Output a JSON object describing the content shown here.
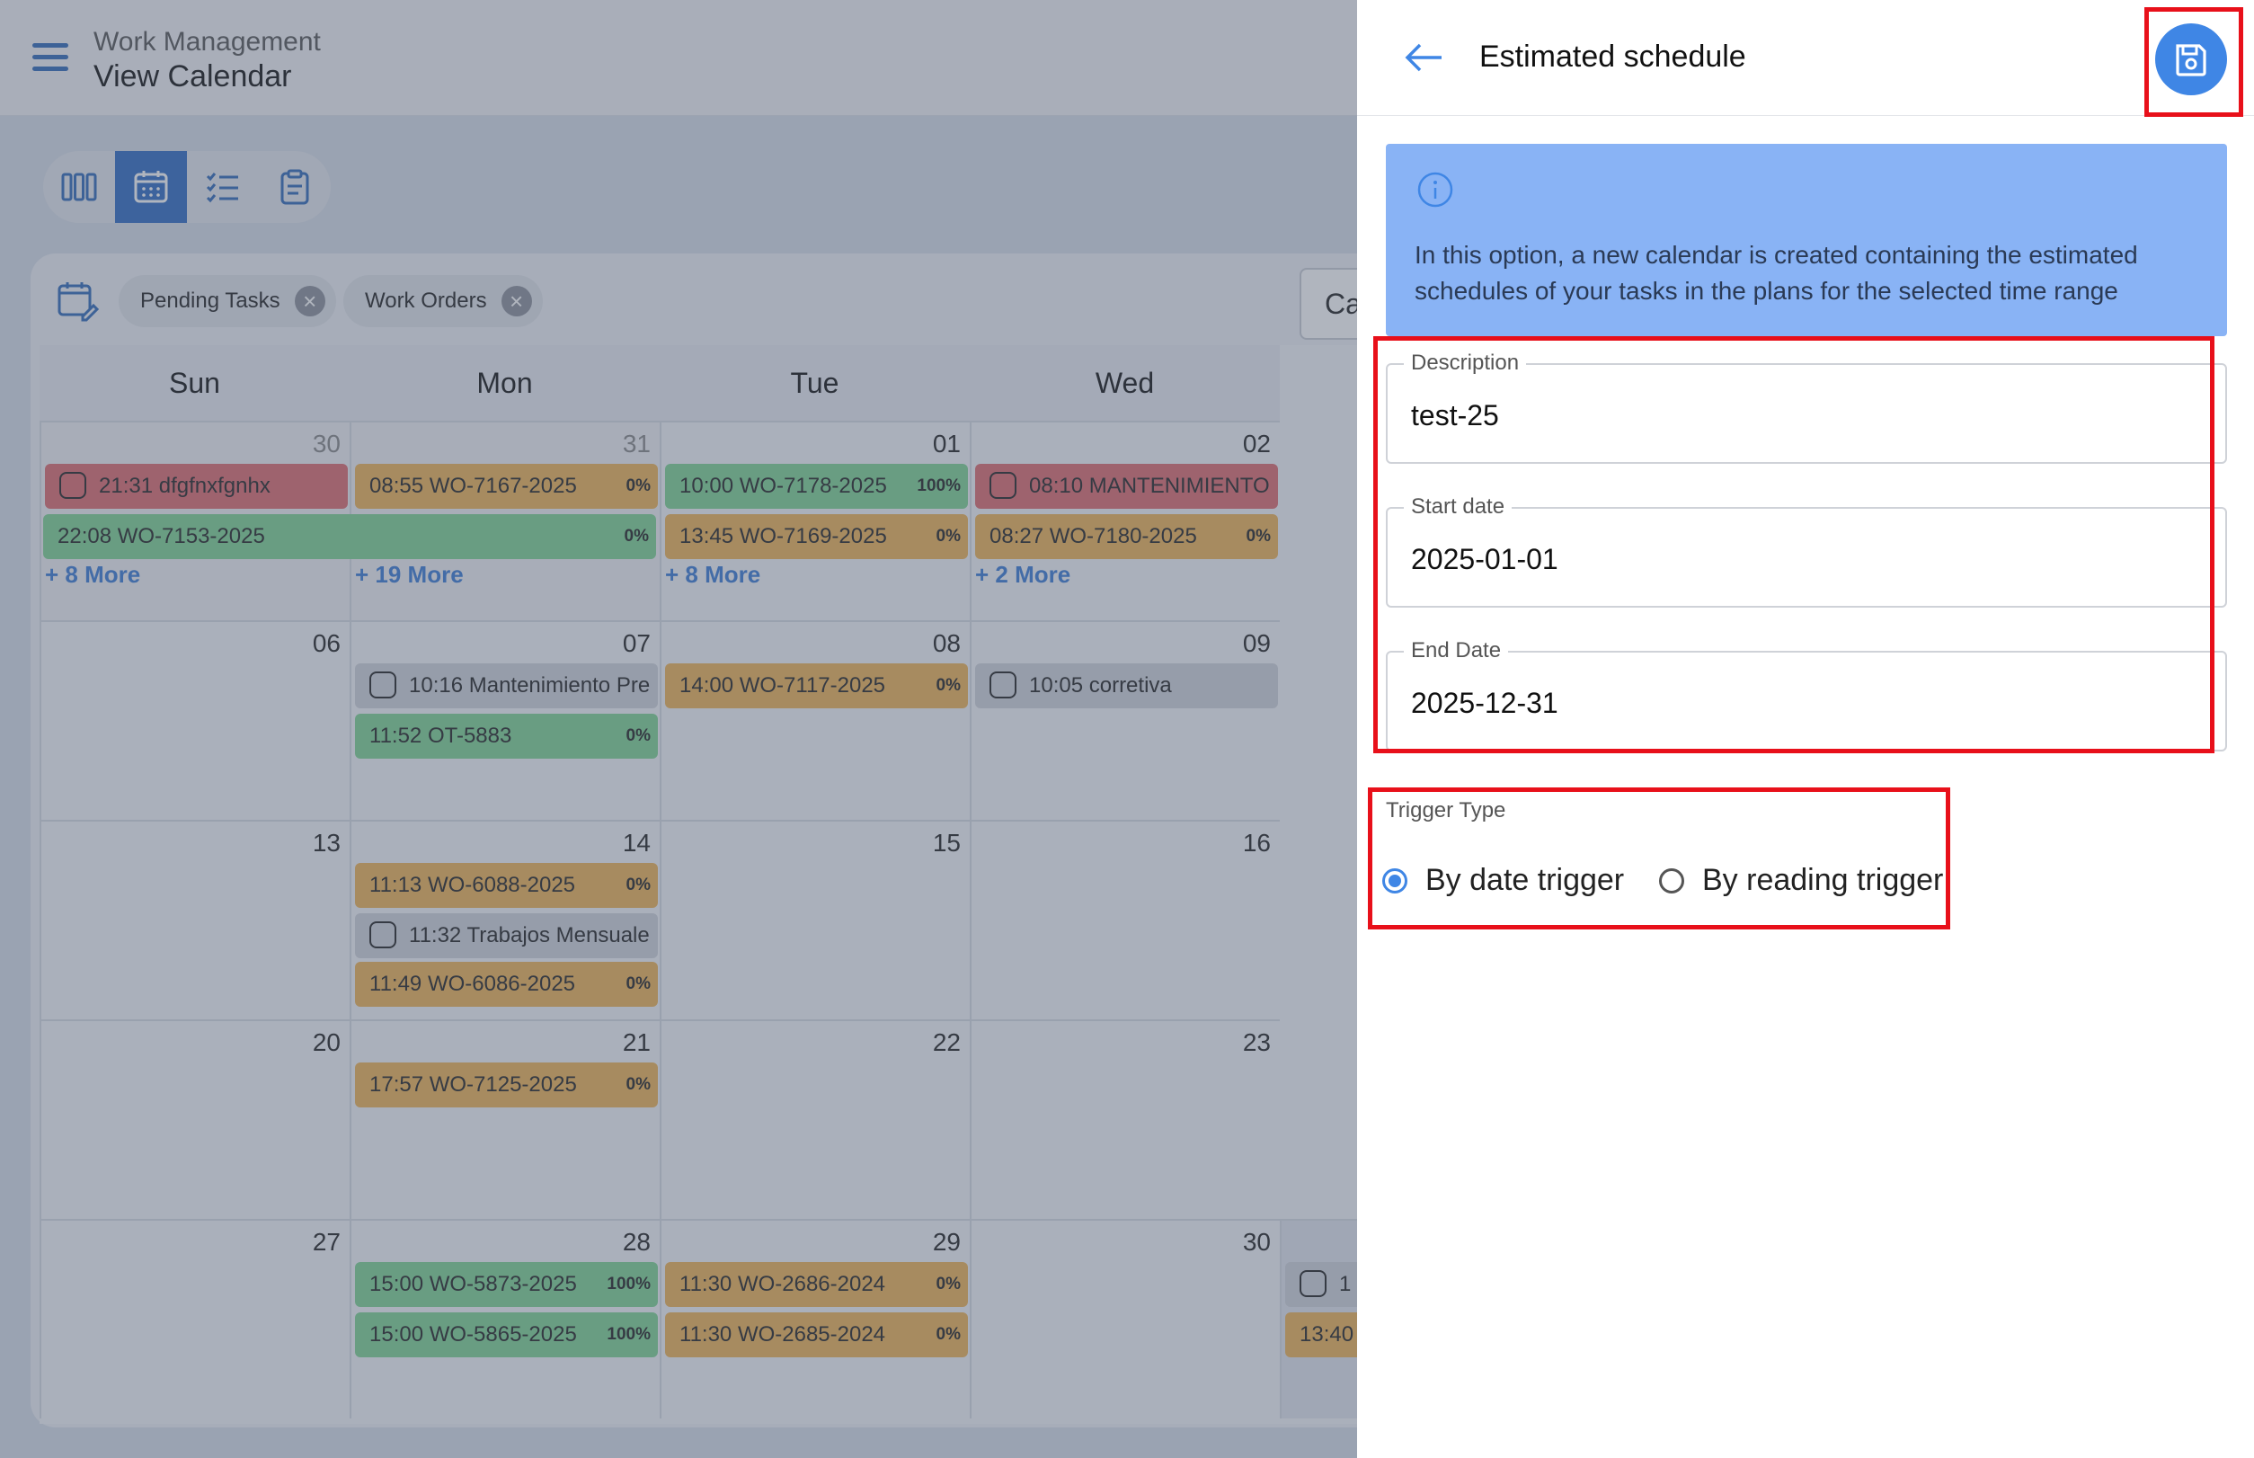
{
  "header": {
    "subtitle": "Work Management",
    "title": "View Calendar"
  },
  "filters": {
    "chips": [
      "Pending Tasks",
      "Work Orders"
    ],
    "search_partial": "Ca"
  },
  "calendar": {
    "days": [
      "Sun",
      "Mon",
      "Tue",
      "Wed"
    ],
    "weeks": [
      {
        "dates": [
          "30",
          "31",
          "01",
          "02"
        ],
        "muted": [
          true,
          true,
          false,
          false
        ],
        "cells": [
          {
            "events": [
              {
                "text": "21:31 dfgfnxfgnhx",
                "color": "red",
                "check": true
              }
            ],
            "more": "+ 8 More"
          },
          {
            "events": [
              {
                "text": "08:55 WO-7167-2025",
                "color": "orange",
                "pct": "0%"
              }
            ],
            "more": "+ 19 More"
          },
          {
            "events": [
              {
                "text": "10:00 WO-7178-2025",
                "color": "green",
                "pct": "100%"
              },
              {
                "text": "13:45 WO-7169-2025",
                "color": "orange",
                "pct": "0%"
              }
            ],
            "more": "+ 8 More"
          },
          {
            "events": [
              {
                "text": "08:10 MANTENIMIENTO",
                "color": "red",
                "check": true
              },
              {
                "text": "08:27 WO-7180-2025",
                "color": "orange",
                "pct": "0%"
              }
            ],
            "more": "+ 2 More"
          }
        ],
        "span_event": {
          "text": "22:08 WO-7153-2025",
          "color": "green",
          "pct": "0%"
        }
      },
      {
        "dates": [
          "06",
          "07",
          "08",
          "09"
        ],
        "cells": [
          {
            "events": []
          },
          {
            "events": [
              {
                "text": "10:16 Mantenimiento Pre",
                "color": "gray",
                "check": true
              },
              {
                "text": "11:52 OT-5883",
                "color": "green",
                "pct": "0%"
              }
            ]
          },
          {
            "events": [
              {
                "text": "14:00 WO-7117-2025",
                "color": "orange",
                "pct": "0%"
              }
            ]
          },
          {
            "events": [
              {
                "text": "10:05 corretiva",
                "color": "gray",
                "check": true
              }
            ]
          }
        ]
      },
      {
        "dates": [
          "13",
          "14",
          "15",
          "16"
        ],
        "cells": [
          {
            "events": []
          },
          {
            "events": [
              {
                "text": "11:13 WO-6088-2025",
                "color": "orange",
                "pct": "0%"
              },
              {
                "text": "11:32 Trabajos Mensuale",
                "color": "gray",
                "check": true
              },
              {
                "text": "11:49 WO-6086-2025",
                "color": "orange",
                "pct": "0%"
              }
            ]
          },
          {
            "events": []
          },
          {
            "events": []
          }
        ]
      },
      {
        "dates": [
          "20",
          "21",
          "22",
          "23"
        ],
        "cells": [
          {
            "events": []
          },
          {
            "events": [
              {
                "text": "17:57 WO-7125-2025",
                "color": "orange",
                "pct": "0%"
              }
            ]
          },
          {
            "events": []
          },
          {
            "events": []
          }
        ]
      },
      {
        "dates": [
          "27",
          "28",
          "29",
          "30"
        ],
        "cells": [
          {
            "events": []
          },
          {
            "events": [
              {
                "text": "15:00 WO-5873-2025",
                "color": "green",
                "pct": "100%"
              },
              {
                "text": "15:00 WO-5865-2025",
                "color": "green",
                "pct": "100%"
              }
            ]
          },
          {
            "events": [
              {
                "text": "11:30 WO-2686-2024",
                "color": "orange",
                "pct": "0%"
              },
              {
                "text": "11:30 WO-2685-2024",
                "color": "orange",
                "pct": "0%"
              }
            ]
          },
          {
            "events": []
          }
        ]
      }
    ],
    "partial_events": [
      {
        "text": "1",
        "color": "gray",
        "check": true
      },
      {
        "text": "13:40",
        "color": "orange"
      }
    ]
  },
  "panel": {
    "title": "Estimated schedule",
    "info": "In this option, a new calendar is created containing the estimated schedules of your tasks in the plans for the selected time range",
    "fields": [
      {
        "label": "Description",
        "value": "test-25"
      },
      {
        "label": "Start date",
        "value": "2025-01-01"
      },
      {
        "label": "End Date",
        "value": "2025-12-31"
      }
    ],
    "trigger_label": "Trigger Type",
    "options": [
      {
        "label": "By date trigger",
        "selected": true
      },
      {
        "label": "By reading trigger",
        "selected": false
      }
    ]
  }
}
